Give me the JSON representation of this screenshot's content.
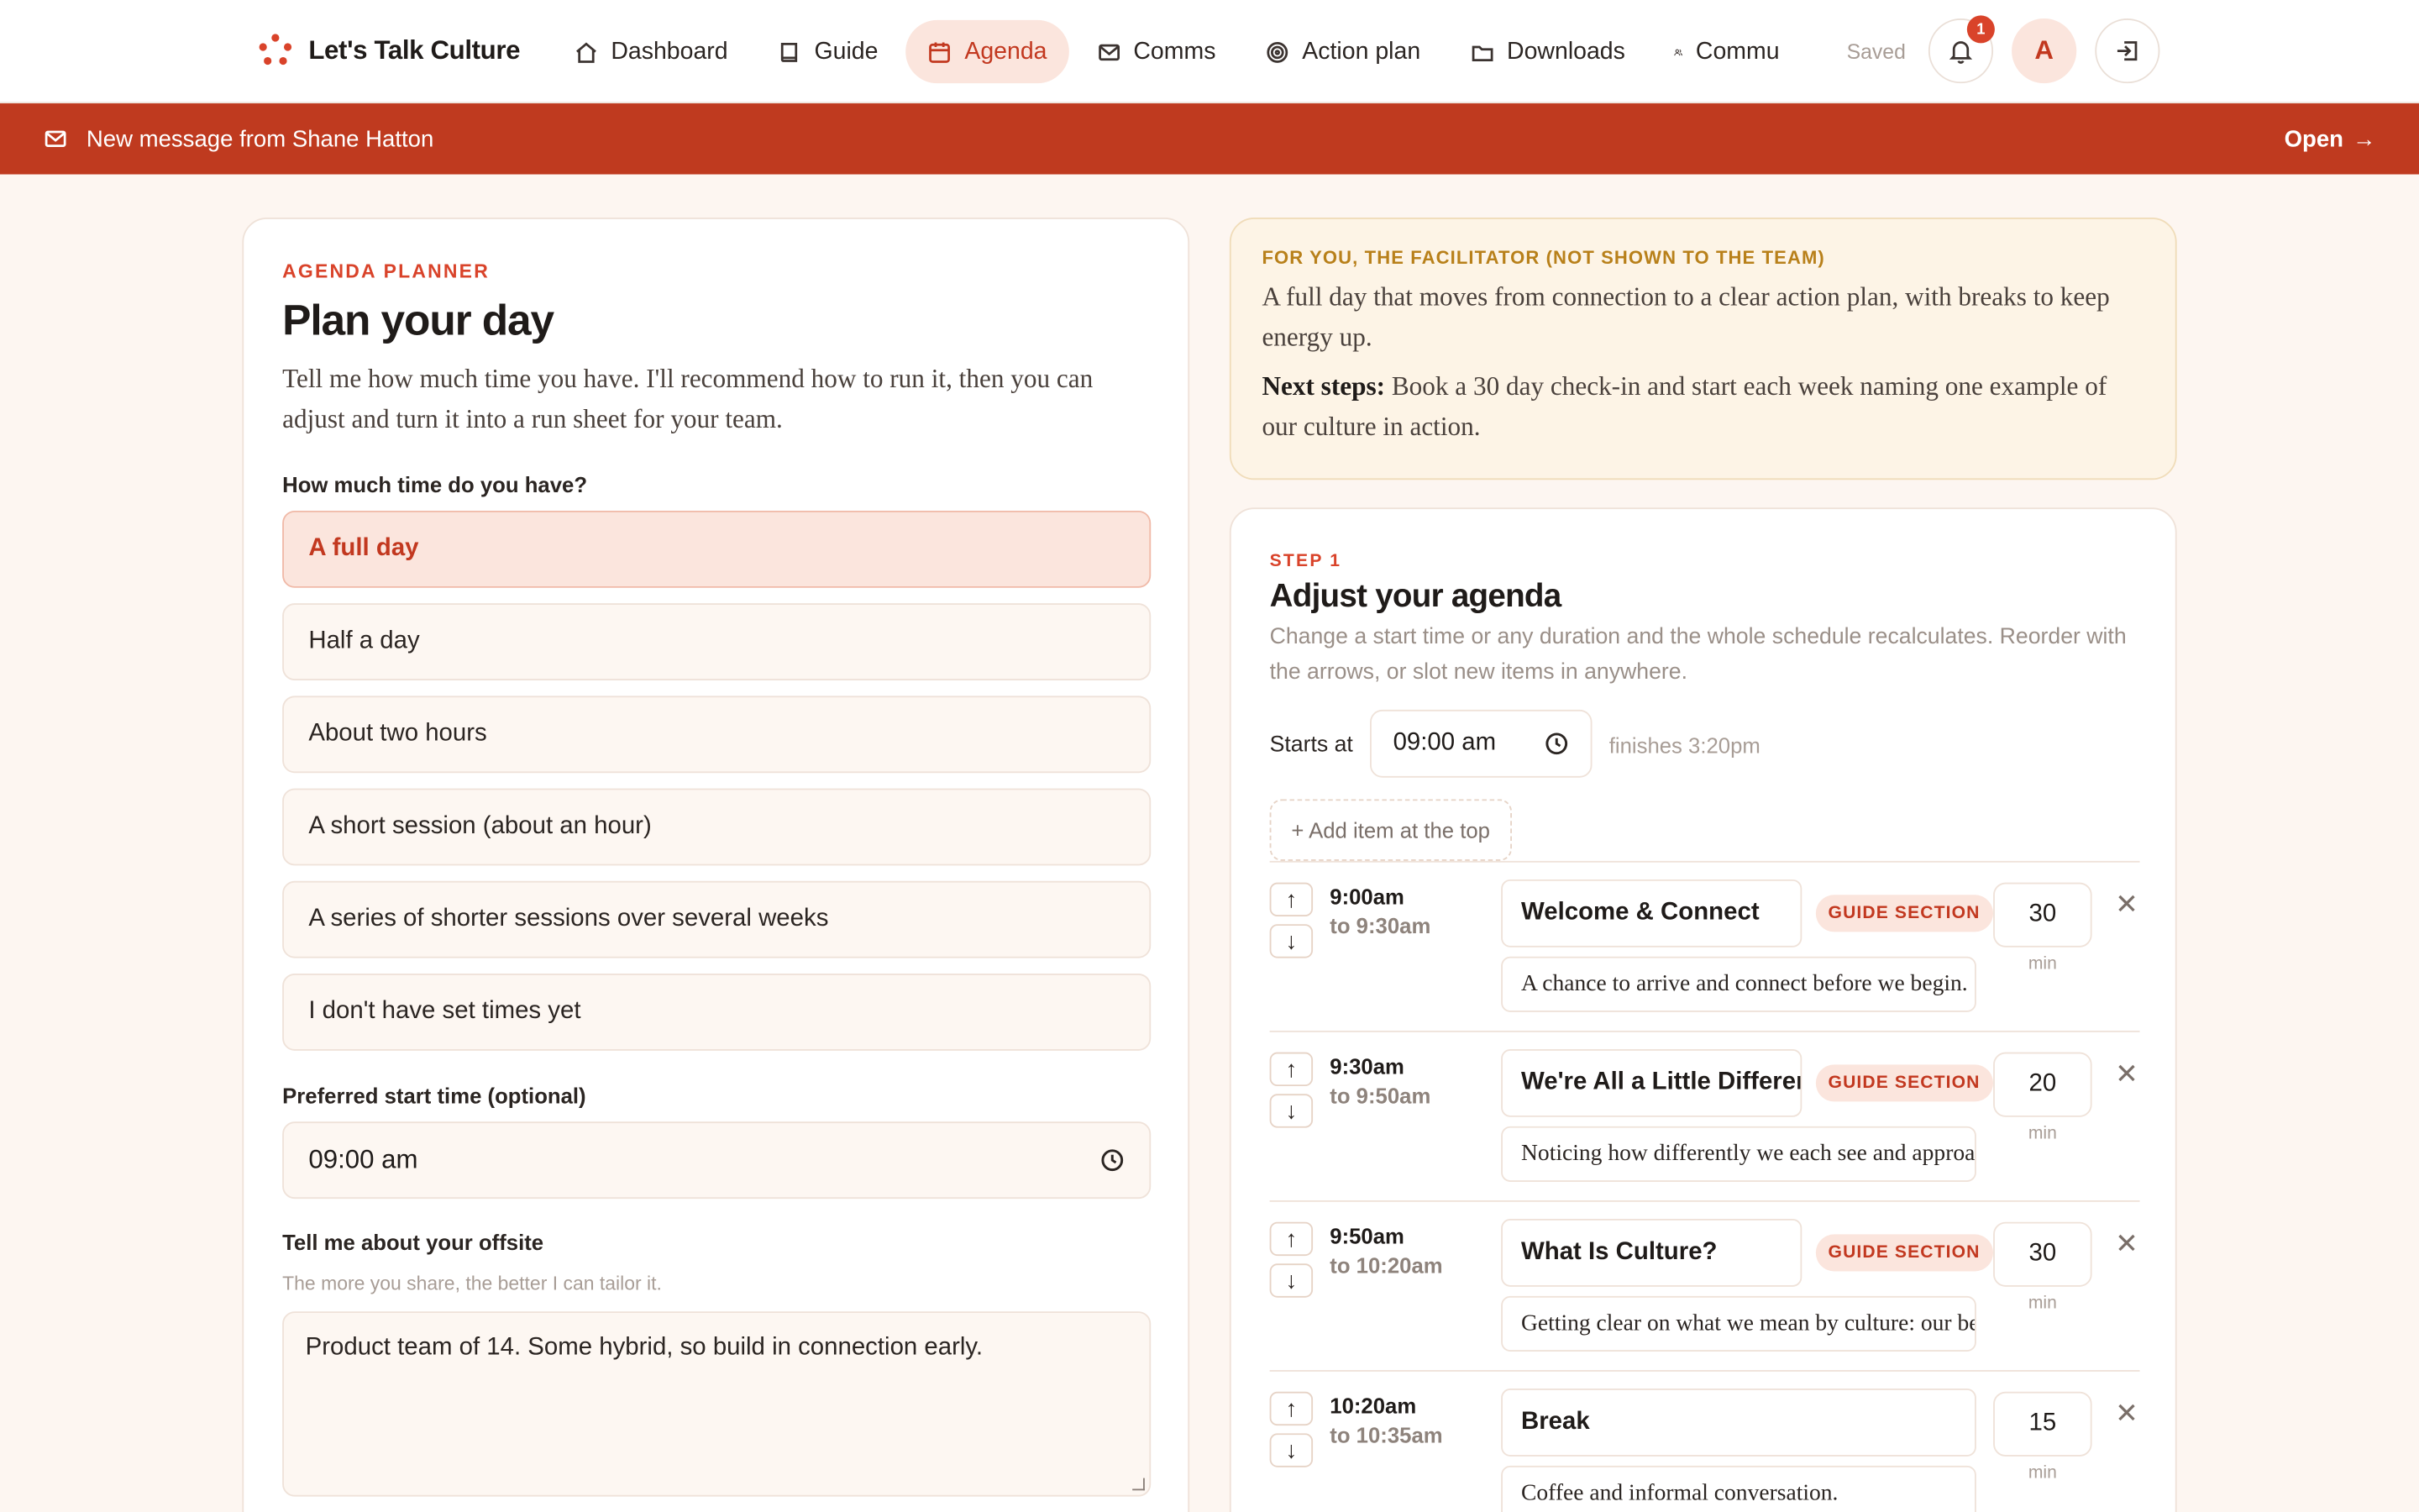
{
  "app": {
    "title": "Let's Talk Culture"
  },
  "nav": {
    "items": [
      {
        "label": "Dashboard"
      },
      {
        "label": "Guide"
      },
      {
        "label": "Agenda"
      },
      {
        "label": "Comms"
      },
      {
        "label": "Action plan"
      },
      {
        "label": "Downloads"
      },
      {
        "label": "Commu"
      }
    ],
    "saved": "Saved",
    "notifications_count": "1",
    "avatar_initial": "A"
  },
  "banner": {
    "message": "New message from Shane Hatton",
    "open_label": "Open"
  },
  "planner": {
    "eyebrow": "AGENDA PLANNER",
    "title": "Plan your day",
    "lead": "Tell me how much time you have. I'll recommend how to run it, then you can adjust and turn it into a run sheet for your team.",
    "time_question": "How much time do you have?",
    "options": [
      {
        "label": "A full day"
      },
      {
        "label": "Half a day"
      },
      {
        "label": "About two hours"
      },
      {
        "label": "A short session (about an hour)"
      },
      {
        "label": "A series of shorter sessions over several weeks"
      },
      {
        "label": "I don't have set times yet"
      }
    ],
    "selected_option": "A full day",
    "start_label": "Preferred start time (optional)",
    "start_value": "09:00 am",
    "offsite_label": "Tell me about your offsite",
    "offsite_hint": "The more you share, the better I can tailor it.",
    "offsite_value": "Product team of 14. Some hybrid, so build in connection early."
  },
  "facilitator_note": {
    "eyebrow": "FOR YOU, THE FACILITATOR (NOT SHOWN TO THE TEAM)",
    "summary": "A full day that moves from connection to a clear action plan, with breaks to keep energy up.",
    "next_steps_label": "Next steps:",
    "next_steps": " Book a 30 day check-in and start each week naming one example of our culture in action."
  },
  "agenda": {
    "eyebrow": "STEP 1",
    "title": "Adjust your agenda",
    "description": "Change a start time or any duration and the whole schedule recalculates. Reorder with the arrows, or slot new items in anywhere.",
    "starts_label": "Starts at",
    "starts_value": "09:00 am",
    "finishes": "finishes 3:20pm",
    "add_top_label": "+ Add item at the top",
    "min_label": "min",
    "items": [
      {
        "start": "9:00am",
        "end": "to 9:30am",
        "title": "Welcome & Connect",
        "tag": "GUIDE SECTION",
        "description": "A chance to arrive and connect before we begin.",
        "duration": "30"
      },
      {
        "start": "9:30am",
        "end": "to 9:50am",
        "title": "We're All a Little Different",
        "tag": "GUIDE SECTION",
        "description": "Noticing how differently we each see and approach things",
        "duration": "20"
      },
      {
        "start": "9:50am",
        "end": "to 10:20am",
        "title": "What Is Culture?",
        "tag": "GUIDE SECTION",
        "description": "Getting clear on what we mean by culture: our behaviours",
        "duration": "30"
      },
      {
        "start": "10:20am",
        "end": "to 10:35am",
        "title": "Break",
        "tag": "",
        "description": "Coffee and informal conversation.",
        "duration": "15"
      }
    ]
  },
  "colors": {
    "accent": "#d9432a",
    "banner": "#bf3a1f",
    "background": "#fdf6f1",
    "note_bg": "#fdf4e6"
  }
}
